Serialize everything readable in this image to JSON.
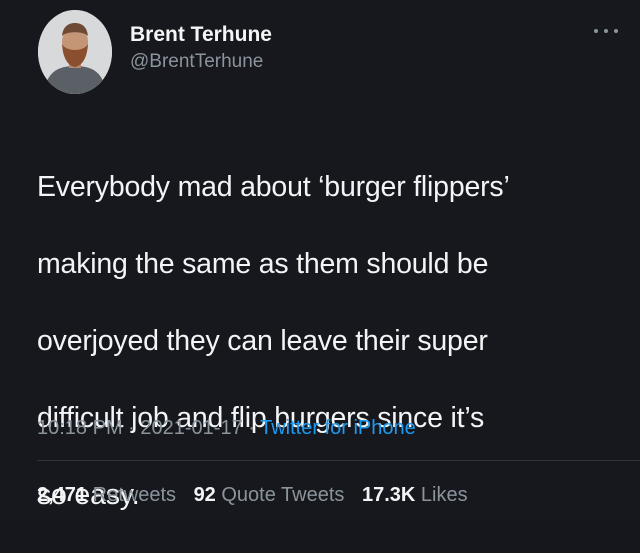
{
  "author": {
    "display_name": "Brent Terhune",
    "handle": "@BrentTerhune"
  },
  "tweet": {
    "text_lines": [
      "Everybody mad about ‘burger flippers’",
      "making the same as them should be",
      "overjoyed they can leave their super",
      "difficult job and flip burgers since it’s",
      "so easy."
    ]
  },
  "meta": {
    "time": "10:18 PM",
    "sep1": " · ",
    "date": "2021-01-17",
    "sep2": " · ",
    "source": "Twitter for iPhone"
  },
  "stats": {
    "retweets_count": "2,471",
    "retweets_label": "Retweets",
    "quotes_count": "92",
    "quotes_label": "Quote Tweets",
    "likes_count": "17.3K",
    "likes_label": "Likes"
  },
  "icons": {
    "more": "more-horizontal-icon"
  },
  "colors": {
    "background": "#16181d",
    "text": "#f3f4f5",
    "secondary": "#8b949c",
    "link": "#1d9bf0"
  }
}
